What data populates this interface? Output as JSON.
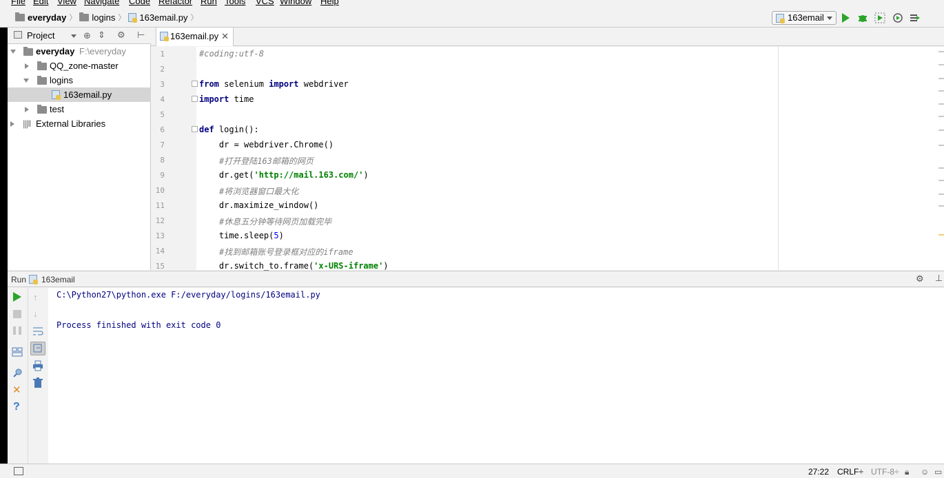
{
  "menu": [
    "File",
    "Edit",
    "View",
    "Navigate",
    "Code",
    "Refactor",
    "Run",
    "Tools",
    "VCS",
    "Window",
    "Help"
  ],
  "breadcrumb": {
    "project": "everyday",
    "folder": "logins",
    "file": "163email.py"
  },
  "toolbar": {
    "run_config": "163email",
    "icons": [
      "run-icon",
      "debug-icon",
      "coverage-icon",
      "profile-icon",
      "concurrency-icon"
    ]
  },
  "project_panel": {
    "title": "Project",
    "tree": [
      {
        "label": "everyday",
        "path": "F:\\everyday",
        "level": 0,
        "expanded": true,
        "type": "folder"
      },
      {
        "label": "QQ_zone-master",
        "level": 1,
        "expanded": false,
        "type": "folder"
      },
      {
        "label": "logins",
        "level": 1,
        "expanded": true,
        "type": "folder"
      },
      {
        "label": "163email.py",
        "level": 2,
        "type": "file",
        "selected": true
      },
      {
        "label": "test",
        "level": 1,
        "expanded": false,
        "type": "folder"
      },
      {
        "label": "External Libraries",
        "level": 0,
        "expanded": false,
        "type": "library"
      }
    ]
  },
  "editor": {
    "tab_label": "163email.py",
    "line_numbers": [
      "1",
      "2",
      "3",
      "4",
      "5",
      "6",
      "7",
      "8",
      "9",
      "10",
      "11",
      "12",
      "13",
      "14",
      "15"
    ],
    "lines": {
      "l1": "#coding:utf-8",
      "l3_kw1": "from",
      "l3_mid": " selenium ",
      "l3_kw2": "import",
      "l3_end": " webdriver",
      "l4_kw": "import",
      "l4_end": " time",
      "l6_kw": "def",
      "l6_end": " login():",
      "l7": "    dr = webdriver.Chrome()",
      "l8": "#打开登陆163邮箱的网页",
      "l9_a": "    dr.get(",
      "l9_s": "'http://mail.163.com/'",
      "l9_b": ")",
      "l10": "#将浏览器窗口最大化",
      "l11": "    dr.maximize_window()",
      "l12": "#休息五分钟等待网页加载完毕",
      "l13_a": "    time.sleep(",
      "l13_n": "5",
      "l13_b": ")",
      "l14": "#找到邮箱账号登录框对应的iframe",
      "l15_a": "    dr.switch_to.frame(",
      "l15_s": "'x-URS-iframe'",
      "l15_b": ")"
    }
  },
  "run_panel": {
    "title": "Run",
    "config": "163email",
    "output": [
      "C:\\Python27\\python.exe F:/everyday/logins/163email.py",
      "",
      "Process finished with exit code 0"
    ]
  },
  "status_bar": {
    "position": "27:22",
    "line_sep": "CRLF÷",
    "encoding": "UTF-8÷"
  },
  "colors": {
    "keyword": "#000080",
    "string": "#008000",
    "comment": "#808080",
    "number": "#0000ff",
    "run_green": "#2aa52a"
  }
}
